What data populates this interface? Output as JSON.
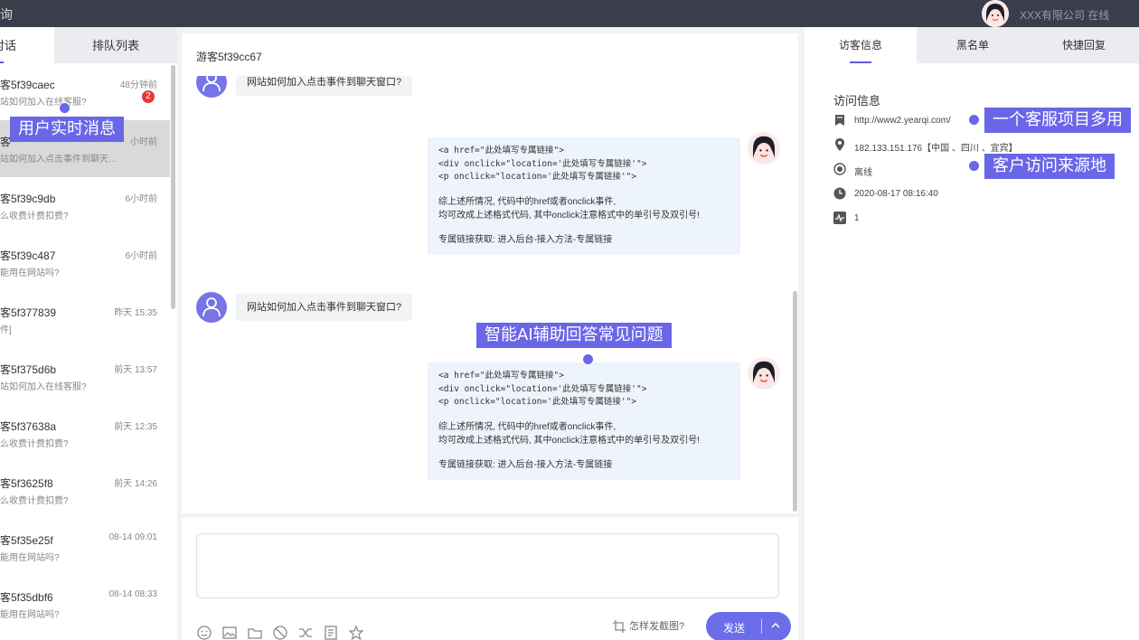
{
  "topbar": {
    "app_title": "询",
    "company": "XXX有限公司 在线"
  },
  "left": {
    "tabs": {
      "active": "对话",
      "queue": "排队列表"
    },
    "conversations": [
      {
        "name": "客5f39caec",
        "time": "48分钟前",
        "msg": "站如何加入在线客服?",
        "badge": "2"
      },
      {
        "name": "客",
        "time": "小时前",
        "msg": "站如何加入点击事件到聊天…"
      },
      {
        "name": "客5f39c9db",
        "time": "6小时前",
        "msg": "么收费计费扣费?"
      },
      {
        "name": "客5f39c487",
        "time": "6小时前",
        "msg": "能用在网站吗?"
      },
      {
        "name": "客5f377839",
        "time": "昨天 15:35",
        "msg": "件]"
      },
      {
        "name": "客5f375d6b",
        "time": "前天 13:57",
        "msg": "站如何加入在线客服?"
      },
      {
        "name": "客5f37638a",
        "time": "前天 12:35",
        "msg": "么收费计费扣费?"
      },
      {
        "name": "客5f3625f8",
        "time": "前天 14:26",
        "msg": "么收费计费扣费?"
      },
      {
        "name": "客5f35e25f",
        "time": "08-14 09:01",
        "msg": "能用在网站吗?"
      },
      {
        "name": "客5f35dbf6",
        "time": "08-14 08:33",
        "msg": "能用在网站吗?"
      }
    ]
  },
  "chat": {
    "visitor": "游客5f39cc67",
    "question": "网站如何加入点击事件到聊天窗口?",
    "answer_code": "<a href=\"此处填写专属链接\">\n<div onclick=\"location='此处填写专属链接'\">\n<p onclick=\"location='此处填写专属链接'\">",
    "answer_line1": "综上述所情况, 代码中的href或者onclick事件,",
    "answer_line2": "均可改成上述格式代码, 其中onclick注意格式中的单引号及双引号!",
    "answer_line3": "专属链接获取: 进入后台-接入方法-专属链接"
  },
  "input": {
    "screenshot_hint": "怎样发截图?",
    "send_label": "发送",
    "tools": [
      "smile-icon",
      "image-icon",
      "folder-icon",
      "block-icon",
      "transfer-icon",
      "doc-icon",
      "star-icon"
    ]
  },
  "right": {
    "tabs": [
      "访客信息",
      "黑名单",
      "快捷回复"
    ],
    "title": "访问信息",
    "rows": [
      {
        "icon": "bookmark-icon",
        "value": "http://www2.yearqi.com/"
      },
      {
        "icon": "location-icon",
        "value": "182.133.151.176【中国 、四川 、宜宾】"
      },
      {
        "icon": "status-icon",
        "value": "离线"
      },
      {
        "icon": "clock-icon",
        "value": "2020-08-17 08:16:40"
      },
      {
        "icon": "activity-icon",
        "value": "1"
      }
    ]
  },
  "annotations": {
    "realtime": "用户实时消息",
    "ai": "智能AI辅助回答常见问题",
    "multi": "一个客服项目多用",
    "source": "客户访问来源地"
  },
  "colors": {
    "accent": "#6c6ee9",
    "topbar": "#3a3d4a",
    "badge": "#e8373a"
  }
}
